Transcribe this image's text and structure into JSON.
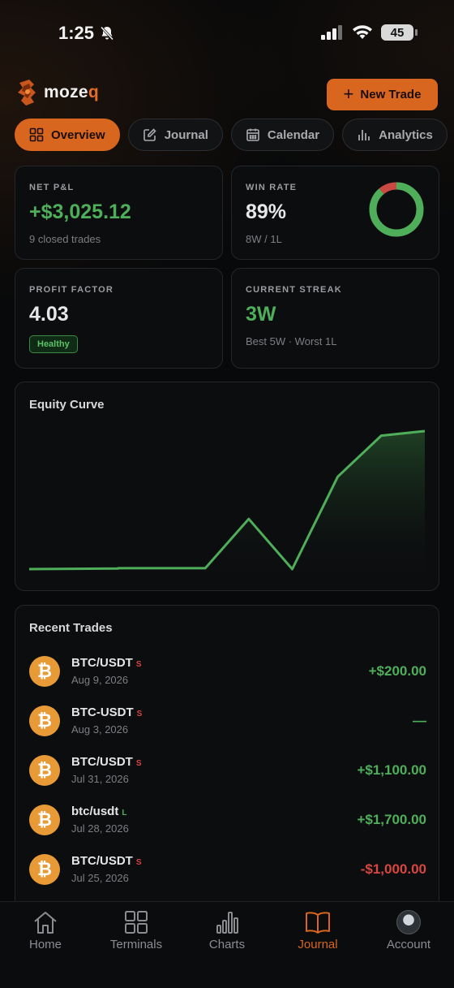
{
  "status_bar": {
    "time": "1:25",
    "battery": "45"
  },
  "header": {
    "brand_main": "moze",
    "brand_accent": "q",
    "new_trade_label": "New Trade"
  },
  "tabs": [
    {
      "label": "Overview",
      "icon": "grid-icon",
      "active": true
    },
    {
      "label": "Journal",
      "icon": "edit-icon",
      "active": false
    },
    {
      "label": "Calendar",
      "icon": "calendar-icon",
      "active": false
    },
    {
      "label": "Analytics",
      "icon": "bar-chart-icon",
      "active": false
    }
  ],
  "stats": {
    "net_pnl": {
      "label": "NET P&L",
      "value": "+$3,025.12",
      "sub": "9 closed trades"
    },
    "win_rate": {
      "label": "WIN RATE",
      "value": "89%",
      "sub": "8W / 1L",
      "wins": 8,
      "losses": 1
    },
    "profit_factor": {
      "label": "PROFIT FACTOR",
      "value": "4.03",
      "badge": "Healthy"
    },
    "streak": {
      "label": "CURRENT STREAK",
      "value": "3W",
      "sub": "Best 5W · Worst 1L"
    }
  },
  "equity_curve": {
    "title": "Equity Curve",
    "chart_data": {
      "type": "area",
      "values": [
        0,
        15,
        20,
        20,
        1100,
        0,
        2025,
        2925,
        3025.12
      ],
      "color": "#4fae5a"
    }
  },
  "recent_trades": {
    "title": "Recent Trades",
    "items": [
      {
        "pair": "BTC/USDT",
        "side": "S",
        "date": "Aug 9, 2026",
        "amount": "+$200.00",
        "tone": "green"
      },
      {
        "pair": "BTC-USDT",
        "side": "S",
        "date": "Aug 3, 2026",
        "amount": "—",
        "tone": "green"
      },
      {
        "pair": "BTC/USDT",
        "side": "S",
        "date": "Jul 31, 2026",
        "amount": "+$1,100.00",
        "tone": "green"
      },
      {
        "pair": "btc/usdt",
        "side": "L",
        "date": "Jul 28, 2026",
        "amount": "+$1,700.00",
        "tone": "green"
      },
      {
        "pair": "BTC/USDT",
        "side": "S",
        "date": "Jul 25, 2026",
        "amount": "-$1,000.00",
        "tone": "red"
      }
    ]
  },
  "bottom_nav": [
    {
      "label": "Home",
      "icon": "home-icon",
      "active": false
    },
    {
      "label": "Terminals",
      "icon": "terminals-grid-icon",
      "active": false
    },
    {
      "label": "Charts",
      "icon": "charts-icon",
      "active": false
    },
    {
      "label": "Journal",
      "icon": "book-icon",
      "active": true
    },
    {
      "label": "Account",
      "icon": "avatar",
      "active": false
    }
  ],
  "colors": {
    "accent": "#d8661f",
    "profit": "#4fae5a",
    "loss": "#d8463f",
    "background": "#08090a"
  }
}
